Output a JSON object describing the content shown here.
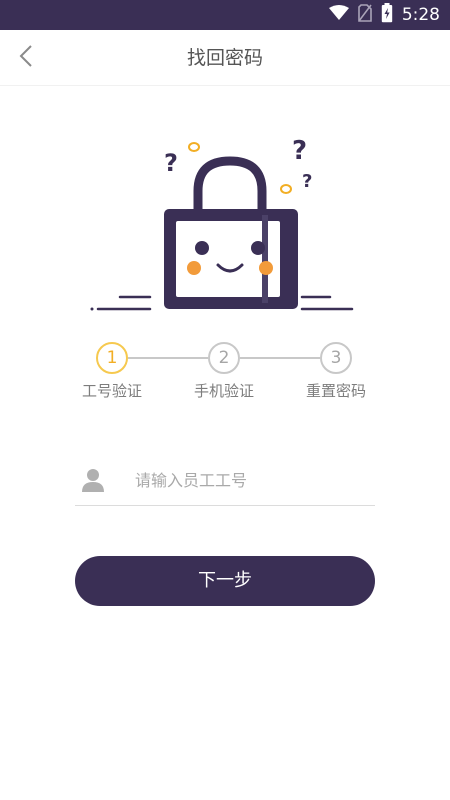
{
  "status_bar": {
    "time": "5:28",
    "icons": [
      "wifi-icon",
      "no-sim-icon",
      "battery-charging-icon"
    ],
    "background": "#3a2f55"
  },
  "header": {
    "title": "找回密码",
    "back_icon": "chevron-left-icon"
  },
  "illustration": {
    "name": "confused-lock-mascot",
    "colors": {
      "outline": "#3a2f55",
      "face": "#ffffff",
      "cheeks": "#f29b3a",
      "accent": "#f2ae24"
    }
  },
  "steps": [
    {
      "number": "1",
      "label": "工号验证",
      "active": true
    },
    {
      "number": "2",
      "label": "手机验证",
      "active": false
    },
    {
      "number": "3",
      "label": "重置密码",
      "active": false
    }
  ],
  "form": {
    "employee_id": {
      "icon": "user-icon",
      "value": "",
      "placeholder": "请输入员工工号"
    }
  },
  "actions": {
    "next_label": "下一步"
  },
  "colors": {
    "primary": "#3a2f55",
    "step_active": "#f6c94f",
    "step_inactive": "#c8c8c8",
    "text_muted": "#a9a9a9"
  }
}
